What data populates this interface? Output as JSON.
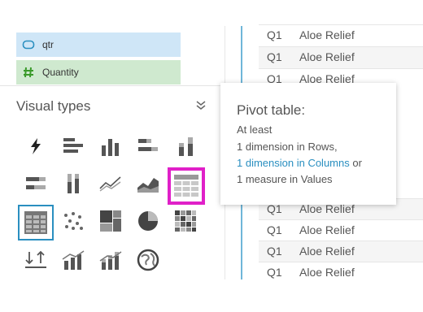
{
  "fields": {
    "dimension": {
      "label": "qtr",
      "icon": "dimension-tag-icon",
      "color": "#cfe6f7"
    },
    "measure": {
      "label": "Quantity",
      "icon": "hash-icon",
      "color": "#cfe9cf"
    }
  },
  "visual_types": {
    "title": "Visual types",
    "icons": [
      "lightning-icon",
      "horizontal-bar-icon",
      "vertical-bar-icon",
      "stacked-horizontal-bar-icon",
      "stacked-vertical-bar-icon",
      "hundred-percent-horizontal-bar-icon",
      "hundred-percent-vertical-bar-icon",
      "line-chart-icon",
      "area-chart-icon",
      "pivot-table-icon",
      "table-icon",
      "scatter-plot-icon",
      "tree-map-icon",
      "pie-chart-icon",
      "heat-map-icon",
      "kpi-icon",
      "combo-bar-line-icon",
      "combo-stacked-line-icon",
      "geo-map-icon"
    ]
  },
  "tooltip": {
    "title": "Pivot table:",
    "line1": "At least",
    "line2": "1 dimension in Rows,",
    "line3_link": "1 dimension in Columns",
    "line3_rest": " or",
    "line4": "1 measure in Values"
  },
  "table": {
    "rows": [
      {
        "qtr": "Q1",
        "product": "Aloe Relief"
      },
      {
        "qtr": "Q1",
        "product": "Aloe Relief"
      },
      {
        "qtr": "Q1",
        "product": "Aloe Relief"
      },
      {
        "qtr": "Q1",
        "product": "Aloe Relief"
      },
      {
        "qtr": "Q1",
        "product": "Aloe Relief"
      },
      {
        "qtr": "Q1",
        "product": "Aloe Relief"
      },
      {
        "qtr": "Q1",
        "product": "Aloe Relief"
      }
    ]
  },
  "colors": {
    "accent": "#2a8fc0",
    "highlight": "#e020c8",
    "measure": "#3a9a2a"
  }
}
